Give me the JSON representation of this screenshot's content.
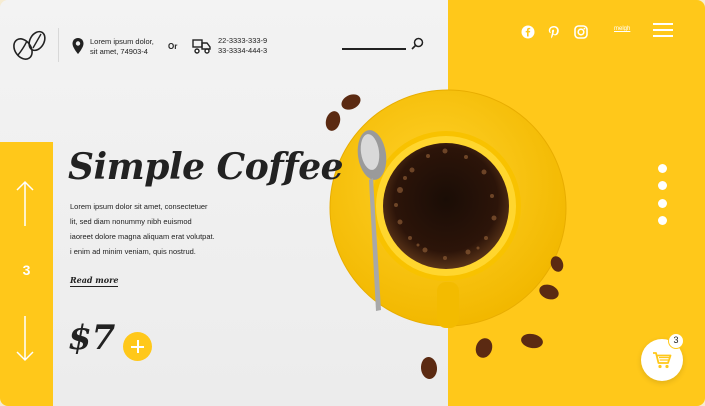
{
  "header": {
    "address_line1": "Lorem ipsum dolor,",
    "address_line2": "sit amet, 74903-4",
    "or_label": "Or",
    "phone1": "22-3333-333-9",
    "phone2": "33-3334-444-3",
    "language": "melgh"
  },
  "social": [
    "facebook-icon",
    "pinterest-icon",
    "instagram-icon"
  ],
  "slider": {
    "current": "3",
    "dots_total": 4
  },
  "hero": {
    "title": "Simple Coffee",
    "desc_lines": [
      "Lorem ipsum dolor sit amet, consectetuer",
      "lit, sed diam nonummy nibh euismod",
      "iaoreet dolore magna aliquam erat volutpat.",
      "i enim ad minim veniam, quis nostrud."
    ],
    "read_more": "Read more",
    "price": "$7"
  },
  "cart": {
    "count": "3"
  },
  "colors": {
    "accent": "#ffc81a",
    "text": "#222222",
    "panel": "#efefef"
  }
}
